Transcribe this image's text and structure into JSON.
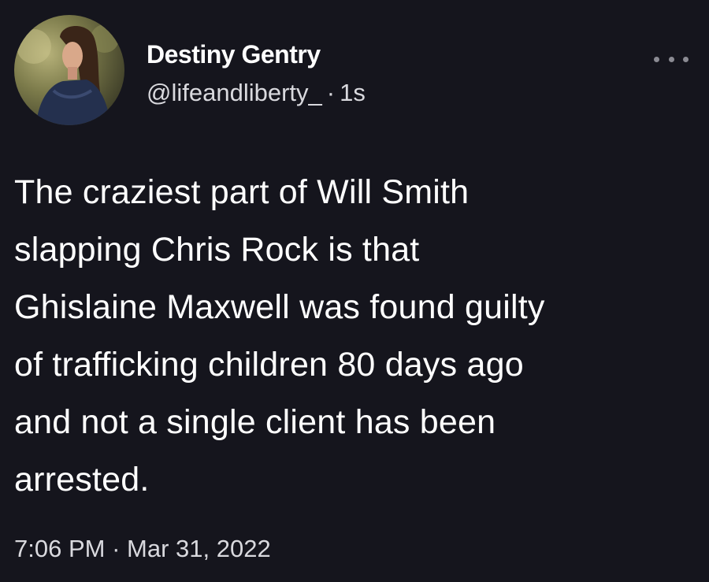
{
  "author": {
    "display_name": "Destiny Gentry",
    "handle": "@lifeandliberty_",
    "separator": "·",
    "time_ago": "1s",
    "avatar_icon": "profile-photo"
  },
  "tweet": {
    "lines": [
      "The craziest part of Will Smith",
      "slapping Chris Rock is that",
      "Ghislaine Maxwell was found guilty",
      "of trafficking children 80 days ago",
      "and not a single client has been",
      "arrested."
    ]
  },
  "footer": {
    "time": "7:06 PM",
    "separator": "·",
    "date": "Mar 31, 2022"
  },
  "more_icon": "ellipsis-icon",
  "colors": {
    "background": "#15151d",
    "text": "#ffffff",
    "secondary_text": "#d9d9de"
  }
}
